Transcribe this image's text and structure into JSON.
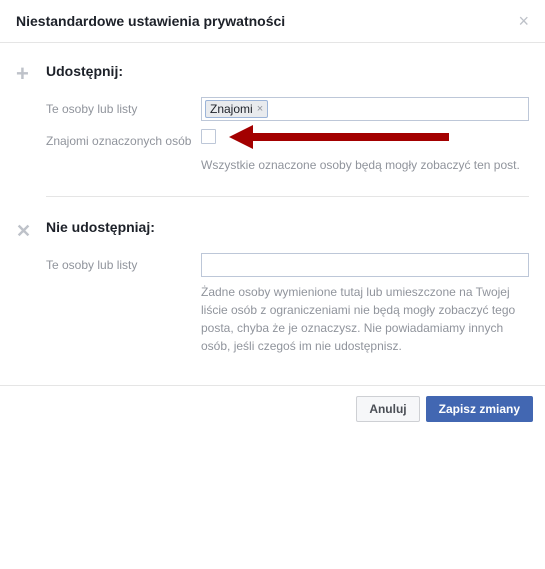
{
  "dialog": {
    "title": "Niestandardowe ustawienia prywatności"
  },
  "share": {
    "title": "Udostępnij:",
    "people_label": "Te osoby lub listy",
    "token_friends": "Znajomi",
    "tagged_label": "Znajomi oznaczonych osób",
    "helper": "Wszystkie oznaczone osoby będą mogły zobaczyć ten post."
  },
  "dont_share": {
    "title": "Nie udostępniaj:",
    "people_label": "Te osoby lub listy",
    "helper": "Żadne osoby wymienione tutaj lub umieszczone na Twojej liście osób z ograniczeniami nie będą mogły zobaczyć tego posta, chyba że je oznaczysz. Nie powiadamiamy innych osób, jeśli czegoś im nie udostępnisz."
  },
  "footer": {
    "cancel": "Anuluj",
    "save": "Zapisz zmiany"
  }
}
